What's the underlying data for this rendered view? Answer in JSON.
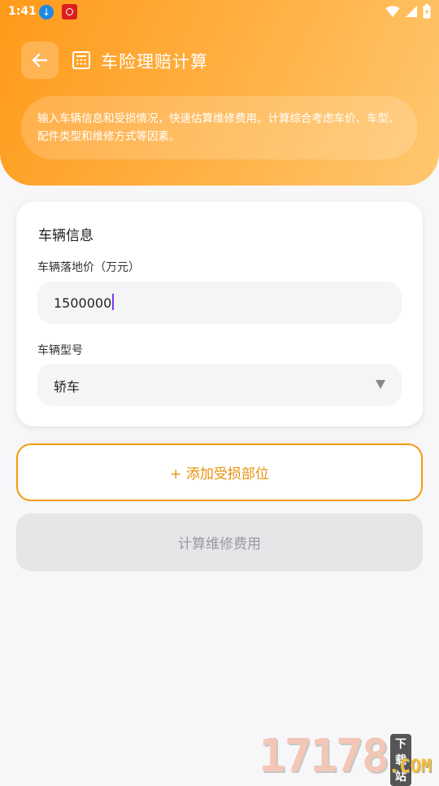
{
  "status_bar": {
    "time": "1:41"
  },
  "header": {
    "title": "车险理赔计算",
    "intro": "输入车辆信息和受损情况，快速估算维修费用。计算综合考虑车价、车型、配件类型和维修方式等因素。"
  },
  "vehicle_card": {
    "title": "车辆信息",
    "price_label": "车辆落地价（万元）",
    "price_value": "1500000",
    "model_label": "车辆型号",
    "model_value": "轿车"
  },
  "buttons": {
    "add_damage": "+ 添加受损部位",
    "calculate": "计算维修费用"
  },
  "watermark": {
    "digits": "17178",
    "tag": "下载站",
    "suffix": ".COM"
  },
  "colors": {
    "accent": "#f29a0c",
    "header_start": "#ff9a1a",
    "header_end": "#ffc770",
    "disabled_bg": "#e5e6e8"
  }
}
